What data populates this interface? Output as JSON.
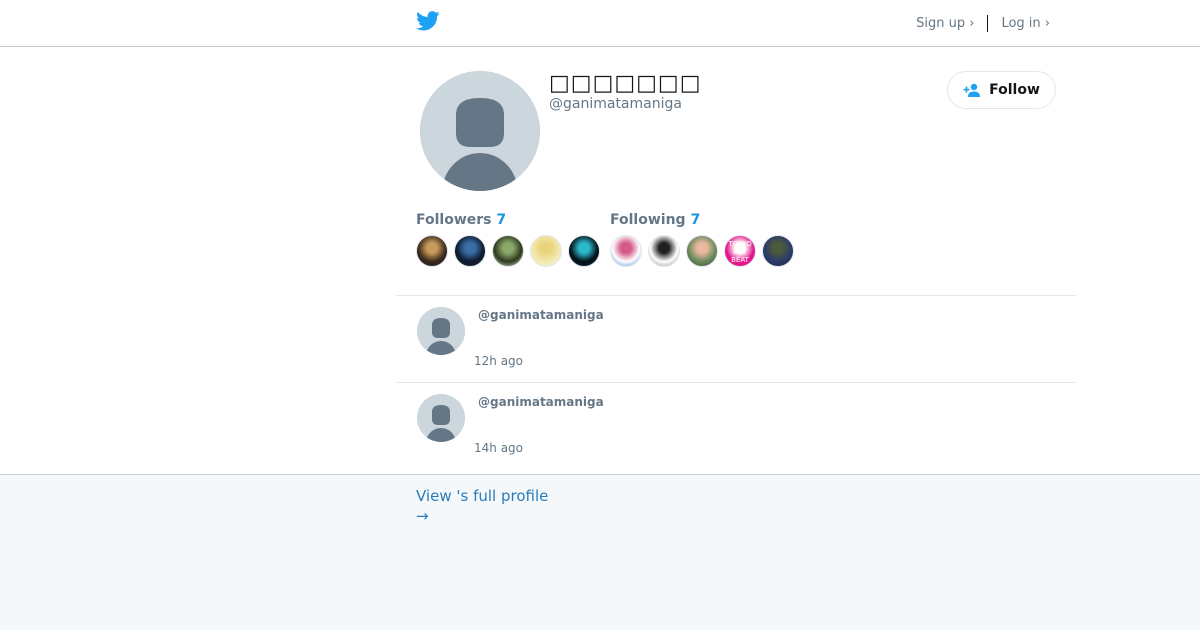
{
  "header": {
    "logo_icon": "twitter-bird-icon",
    "signup_label": "Sign up ›",
    "login_label": "Log in ›"
  },
  "profile": {
    "display_name": "□□□□□□□",
    "handle": "@ganimatamaniga",
    "follow_label": "Follow",
    "followers_label": "Followers",
    "followers_count": "7",
    "following_label": "Following",
    "following_count": "7"
  },
  "followers_avatars": [
    {
      "colors": [
        "#3a2a1e",
        "#c89a5a",
        "#1a1a1a"
      ]
    },
    {
      "colors": [
        "#0f1a2e",
        "#3a6ea5",
        "#1a2a3a"
      ]
    },
    {
      "colors": [
        "#2e3b1e",
        "#8aa86a",
        "#e0e8d8"
      ]
    },
    {
      "colors": [
        "#f3e8b0",
        "#e8d47a",
        "#f7f2d8"
      ]
    },
    {
      "colors": [
        "#061018",
        "#2ab8c8",
        "#0a2a3a"
      ]
    }
  ],
  "following_avatars": [
    {
      "colors": [
        "#ffffff",
        "#d45a8a",
        "#3a7ad4"
      ]
    },
    {
      "colors": [
        "#ffffff",
        "#222222",
        "#888888"
      ]
    },
    {
      "colors": [
        "#6a8a5a",
        "#e8b8a0",
        "#3a4a3a"
      ]
    },
    {
      "colors": [
        "#e4168a",
        "#ffffff",
        "#e4168a"
      ],
      "text": "TOKYO\nART\nBEAT"
    },
    {
      "colors": [
        "#2a3a6a",
        "#4a5a3a",
        "#1a2a4a"
      ]
    }
  ],
  "tweets": [
    {
      "handle": "@ganimatamaniga",
      "time": "12h ago"
    },
    {
      "handle": "@ganimatamaniga",
      "time": "14h ago"
    }
  ],
  "footer": {
    "view_profile_label": "View 's full profile",
    "arrow": "→"
  }
}
